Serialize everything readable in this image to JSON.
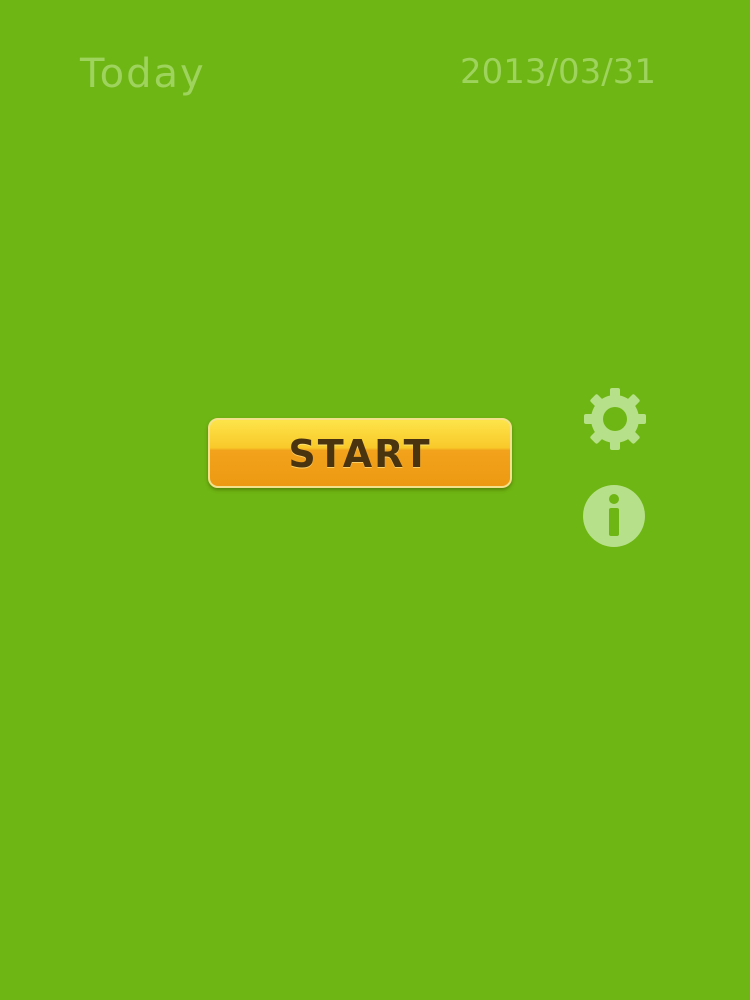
{
  "header": {
    "label": "Today",
    "date": "2013/03/31"
  },
  "main": {
    "start_label": "START"
  },
  "icons": {
    "settings": "gear-icon",
    "info": "info-icon"
  },
  "colors": {
    "background": "#6eb613",
    "header_text": "#9ed35e",
    "button_top": "#fde44a",
    "button_bottom": "#ed9a12",
    "button_text": "#4a3410",
    "icon_fill": "#b7e08a"
  }
}
